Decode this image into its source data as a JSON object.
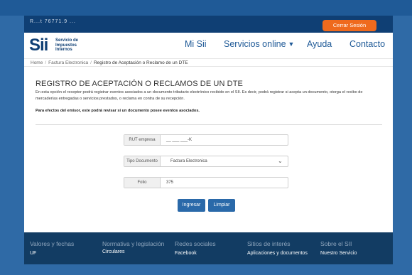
{
  "topbar": {
    "user_text": "R...t 76771.9 ...",
    "logout_label": "Cerrar Sesión"
  },
  "logo": {
    "mark": "Sii",
    "line1": "Servicio de",
    "line2": "Impuestos",
    "line3": "Internos"
  },
  "nav": {
    "items": [
      {
        "label": "Mi Sii"
      },
      {
        "label": "Servicios online"
      },
      {
        "label": "Ayuda"
      },
      {
        "label": "Contacto"
      }
    ]
  },
  "breadcrumb": {
    "home": "Home",
    "section": "Factura Electronica",
    "current": "Registro de Aceptación o Reclamo de un DTE"
  },
  "main": {
    "title": "REGISTRO DE ACEPTACIÓN O RECLAMOS DE UN DTE",
    "description": "En esta opción el receptor podrá registrar eventos asociados a un documento tributario electrónico recibido en el SII. Es decir, podrá registrar si acepta un documento, otorga el recibo de mercaderías entregadas o servicios prestados, o reclama en contra de su recepción.",
    "note": "Para efectos del emisor, este podrá revisar si un documento posee eventos asociados."
  },
  "form": {
    "rut_label": "RUT empresa",
    "rut_value": "__ ___ ___-K",
    "tipo_label": "Tipo Documento",
    "tipo_value": "Factura Electronica",
    "folio_label": "Folio",
    "folio_value": "375",
    "submit_label": "Ingresar",
    "clear_label": "Limpiar"
  },
  "footer": {
    "columns": [
      {
        "heading": "Valores y fechas",
        "link": "UF"
      },
      {
        "heading": "Normativa y legislación",
        "link": "Circulares"
      },
      {
        "heading": "Redes sociales",
        "link": "Facebook"
      },
      {
        "heading": "Sitios de interés",
        "link": "Aplicaciones y documentos"
      },
      {
        "heading": "Sobre el SII",
        "link": "Nuestro Servicio"
      }
    ]
  },
  "colors": {
    "primary": "#0f3f74",
    "accent": "#ef6a1d",
    "button": "#2a69a9",
    "frame": "#2f6aa6"
  }
}
